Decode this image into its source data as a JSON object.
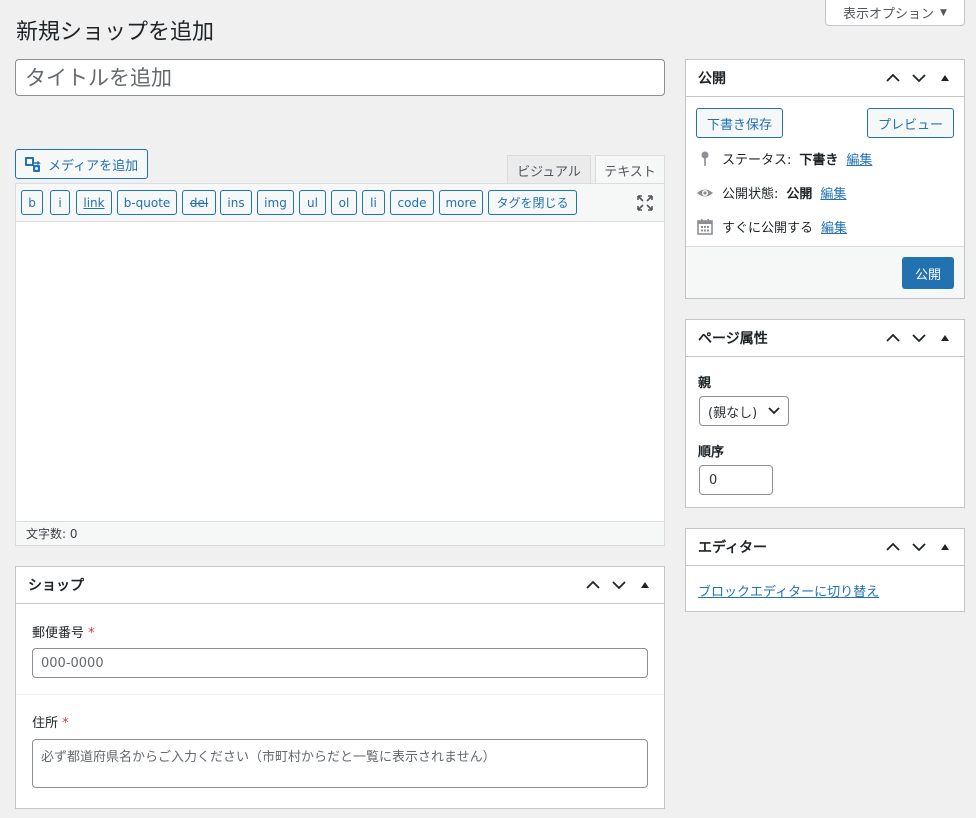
{
  "screen_options": {
    "label": "表示オプション",
    "arrow": "▼"
  },
  "page_title": "新規ショップを追加",
  "title_field": {
    "placeholder": "タイトルを追加",
    "value": ""
  },
  "editor": {
    "add_media_label": "メディアを追加",
    "tabs": [
      "ビジュアル",
      "テキスト"
    ],
    "active_tab": "テキスト",
    "quicktags": [
      "b",
      "i",
      "link",
      "b-quote",
      "del",
      "ins",
      "img",
      "ul",
      "ol",
      "li",
      "code",
      "more",
      "タグを閉じる"
    ],
    "word_count": "文字数: 0"
  },
  "publish_box": {
    "title": "公開",
    "save_draft": "下書き保存",
    "preview": "プレビュー",
    "status_label": "ステータス:",
    "status_value": "下書き",
    "visibility_label": "公開状態:",
    "visibility_value": "公開",
    "schedule_label": "すぐに公開する",
    "edit_link": "編集",
    "publish_button": "公開"
  },
  "page_attributes": {
    "title": "ページ属性",
    "parent_label": "親",
    "parent_value": "(親なし)",
    "order_label": "順序",
    "order_value": "0"
  },
  "editor_box": {
    "title": "エディター",
    "switch_link": "ブロックエディターに切り替え"
  },
  "shop_box": {
    "title": "ショップ",
    "postal_label": "郵便番号",
    "postal_placeholder": "000-0000",
    "address_label": "住所",
    "address_placeholder": "必ず都道府県名からご入力ください（市町村からだと一覧に表示されません）",
    "required_mark": "*"
  },
  "colors": {
    "accent": "#2271b1",
    "required": "#d63638",
    "background": "#f0f0f1"
  }
}
